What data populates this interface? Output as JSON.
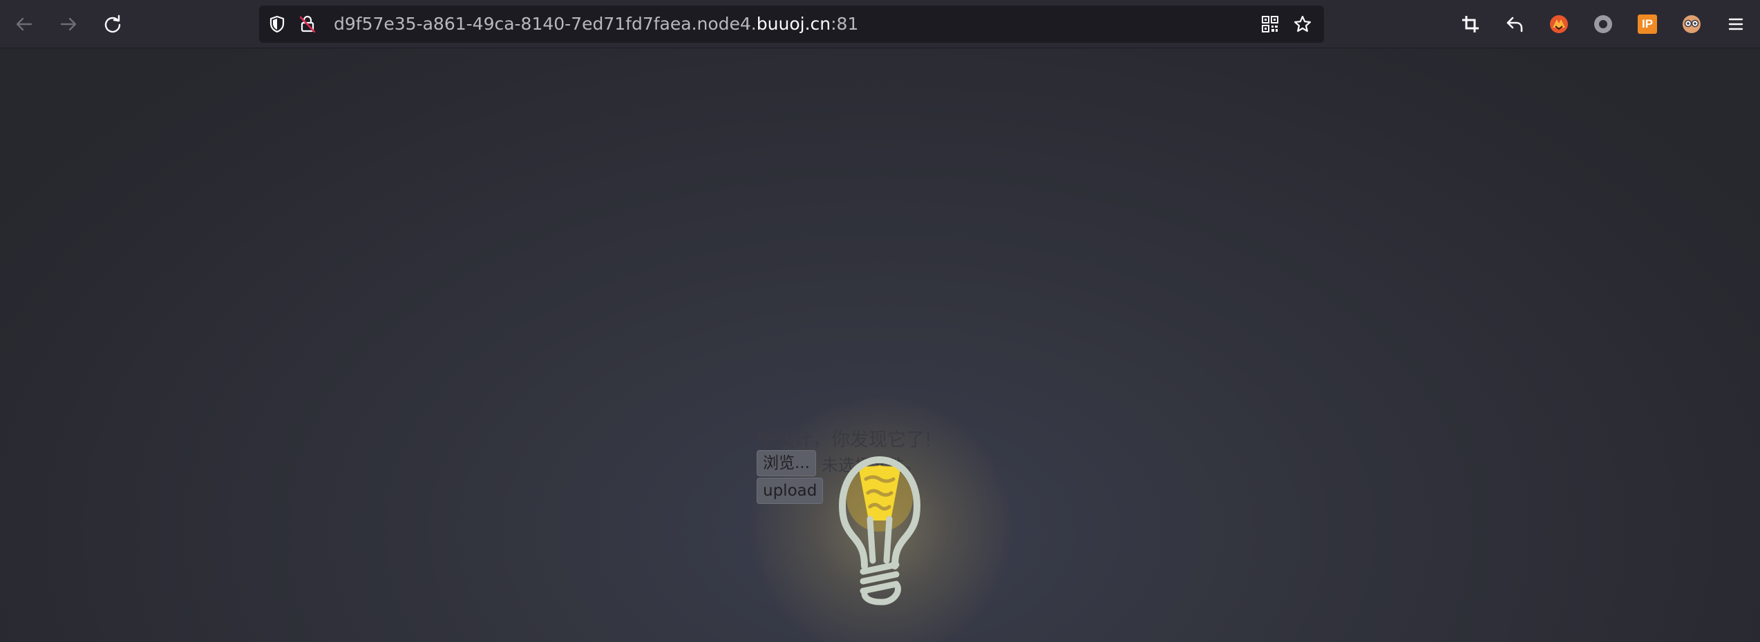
{
  "browser": {
    "url_prefix": "d9f57e35-a861-49ca-8140-7ed71fd7faea.node4.",
    "url_domain": "buuoj.cn",
    "url_port": ":81",
    "icons": {
      "back": "arrow-left-icon",
      "forward": "arrow-right-icon",
      "reload": "reload-icon",
      "shield": "tracking-protection-shield-icon",
      "insecure": "insecure-lock-icon",
      "qr": "qr-code-icon",
      "bookmark": "star-icon",
      "screenshot": "crop-icon",
      "undo": "undo-arrow-icon",
      "ext_fox": "extension-fox-icon",
      "ext_circle": "extension-circle-icon",
      "ext_ip": "extension-ip-icon",
      "ext_glasses": "extension-glasses-icon",
      "menu": "hamburger-menu-icon"
    },
    "ext_ip_label": "IP"
  },
  "page": {
    "headline": "嘿伙计，你发现它了!",
    "browse_label": "浏览...",
    "file_status": "未选择文件。",
    "upload_label": "upload",
    "colors": {
      "background": "#2b2a33",
      "bulb_yellow": "#f5d730",
      "bulb_outline": "#c7d0c5"
    }
  }
}
